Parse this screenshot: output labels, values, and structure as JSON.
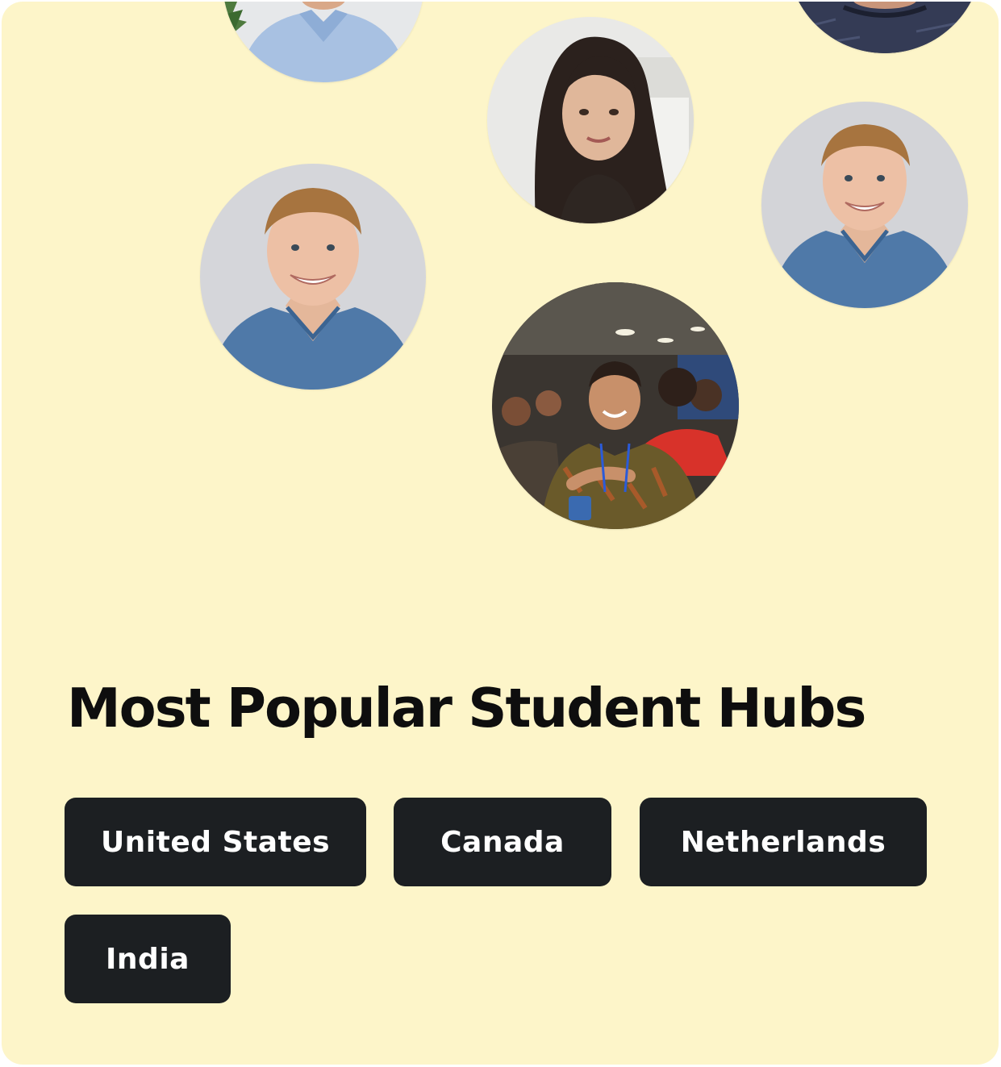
{
  "card": {
    "title": "Most Popular Student Hubs",
    "background_color": "#FDF5C9",
    "title_color": "#0E0E0E"
  },
  "hubs": [
    {
      "label": "United States"
    },
    {
      "label": "Canada"
    },
    {
      "label": "Netherlands"
    },
    {
      "label": "India"
    }
  ],
  "hub_button_style": {
    "background_color": "#1C1F22",
    "text_color": "#FFFFFF"
  },
  "avatars": [
    {
      "description": "man-light-blue-shirt-partial"
    },
    {
      "description": "dark-navy-shirt-partial"
    },
    {
      "description": "woman-long-dark-hair"
    },
    {
      "description": "smiling-man-blue-shirt"
    },
    {
      "description": "smiling-man-blue-shirt"
    },
    {
      "description": "man-at-event-crowd"
    }
  ]
}
